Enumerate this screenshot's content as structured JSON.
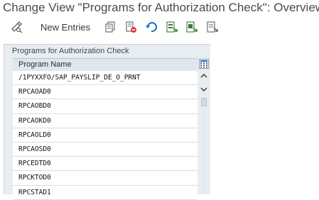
{
  "window": {
    "title": "Change View \"Programs for Authorization Check\": Overview"
  },
  "toolbar": {
    "items": [
      {
        "name": "display-change-icon"
      },
      {
        "name": "new-entries",
        "label": "New Entries"
      },
      {
        "name": "copy-icon"
      },
      {
        "name": "delete-icon"
      },
      {
        "name": "undo-icon"
      },
      {
        "name": "select-all-icon"
      },
      {
        "name": "select-block-icon"
      },
      {
        "name": "deselect-all-icon"
      }
    ]
  },
  "table": {
    "title": "Programs for Authorization Check",
    "column_header": "Program Name",
    "rows": [
      "/1PYXXFO/SAP_PAYSLIP_DE_O_PRNT",
      "RPCAOAD0",
      "RPCAOBD0",
      "RPCAOKD0",
      "RPCAOLD0",
      "RPCAOSD0",
      "RPCEDTD0",
      "RPCKTOD0",
      "RPCSTAD1"
    ]
  },
  "colors": {
    "accent": "#0a6ed1",
    "panel_bg": "#e8edf2",
    "header_bg": "#dfe6ec"
  }
}
